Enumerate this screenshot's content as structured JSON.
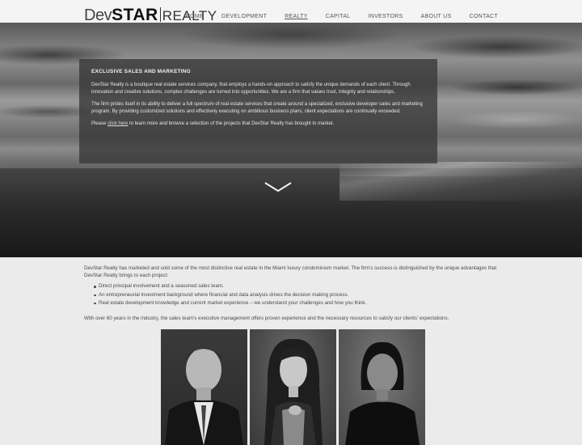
{
  "header": {
    "logo": {
      "dev": "Dev",
      "star": "STAR",
      "realty": "REALTY"
    },
    "nav": [
      {
        "label": "HOME"
      },
      {
        "label": "DEVELOPMENT"
      },
      {
        "label": "REALTY"
      },
      {
        "label": "CAPITAL"
      },
      {
        "label": "INVESTORS"
      },
      {
        "label": "ABOUT US"
      },
      {
        "label": "CONTACT"
      }
    ]
  },
  "hero": {
    "title": "EXCLUSIVE SALES AND MARKETING",
    "para1": "DevStar Realty is a boutique real estate services company, that employs a hands-on approach to satisfy the unique demands of each client. Through innovation and creative solutions, complex challenges are turned into opportunities. We are a firm that values trust, integrity and relationships.",
    "para2": "The firm prides itself in its ability to deliver a full spectrum of real estate services that create around a specialized, exclusive developer sales and marketing program. By providing customized solutions and effectively executing on ambitious business plans, client expectations are continually exceeded.",
    "para3_prefix": "Please",
    "para3_link": "click here",
    "para3_suffix": "to learn more and browse a selection of the projects that DevStar Realty has brought to market."
  },
  "main": {
    "lead": "DevStar Realty has marketed and sold some of the most distinctive real estate in the Miami luxury condominium market. The firm's success is distinguished by the unique advantages that DevStar Realty brings to each project:",
    "bullets": [
      "Direct principal involvement and a seasoned sales team.",
      "An entrepreneurial investment background where financial and data analysis drives the decision making process.",
      "Real estate development knowledge and current market experience – we understand your challenges and how you think."
    ],
    "closing": "With over 60 years in the industry, the sales team's executive management offers proven experience and the necessary resources to satisfy our clients' expectations."
  }
}
